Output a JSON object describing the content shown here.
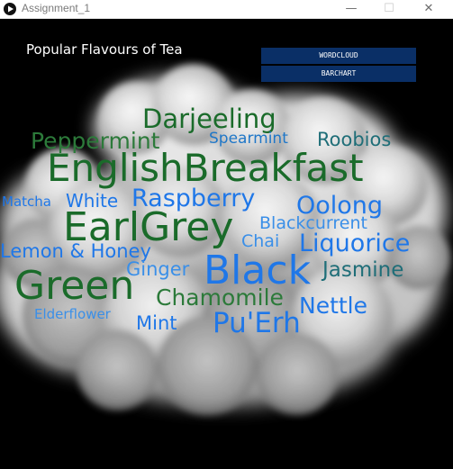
{
  "window": {
    "title": "Assignment_1",
    "minimize": "—",
    "maximize": "☐",
    "close": "✕"
  },
  "page": {
    "title": "Popular Flavours of Tea"
  },
  "buttons": {
    "wordcloud": "WORDCLOUD",
    "barchart": "BARCHART"
  },
  "colors": {
    "button_bg": "#0a2f66",
    "dark_green": "#1a6b2a",
    "green": "#2c7a3a",
    "teal": "#1f6e78",
    "blue": "#1f77e8",
    "light_blue": "#3a8fe8"
  },
  "words": [
    {
      "text": "Darjeeling"
    },
    {
      "text": "Peppermint"
    },
    {
      "text": "Spearmint"
    },
    {
      "text": "Roobios"
    },
    {
      "text": "EnglishBreakfast"
    },
    {
      "text": "Matcha"
    },
    {
      "text": "White"
    },
    {
      "text": "Raspberry"
    },
    {
      "text": "Oolong"
    },
    {
      "text": "EarlGrey"
    },
    {
      "text": "Blackcurrent"
    },
    {
      "text": "Chai"
    },
    {
      "text": "Liquorice"
    },
    {
      "text": "Lemon & Honey"
    },
    {
      "text": "Ginger"
    },
    {
      "text": "Black"
    },
    {
      "text": "Jasmine"
    },
    {
      "text": "Green"
    },
    {
      "text": "Chamomile"
    },
    {
      "text": "Nettle"
    },
    {
      "text": "Elderflower"
    },
    {
      "text": "Mint"
    },
    {
      "text": "Pu'Erh"
    }
  ]
}
